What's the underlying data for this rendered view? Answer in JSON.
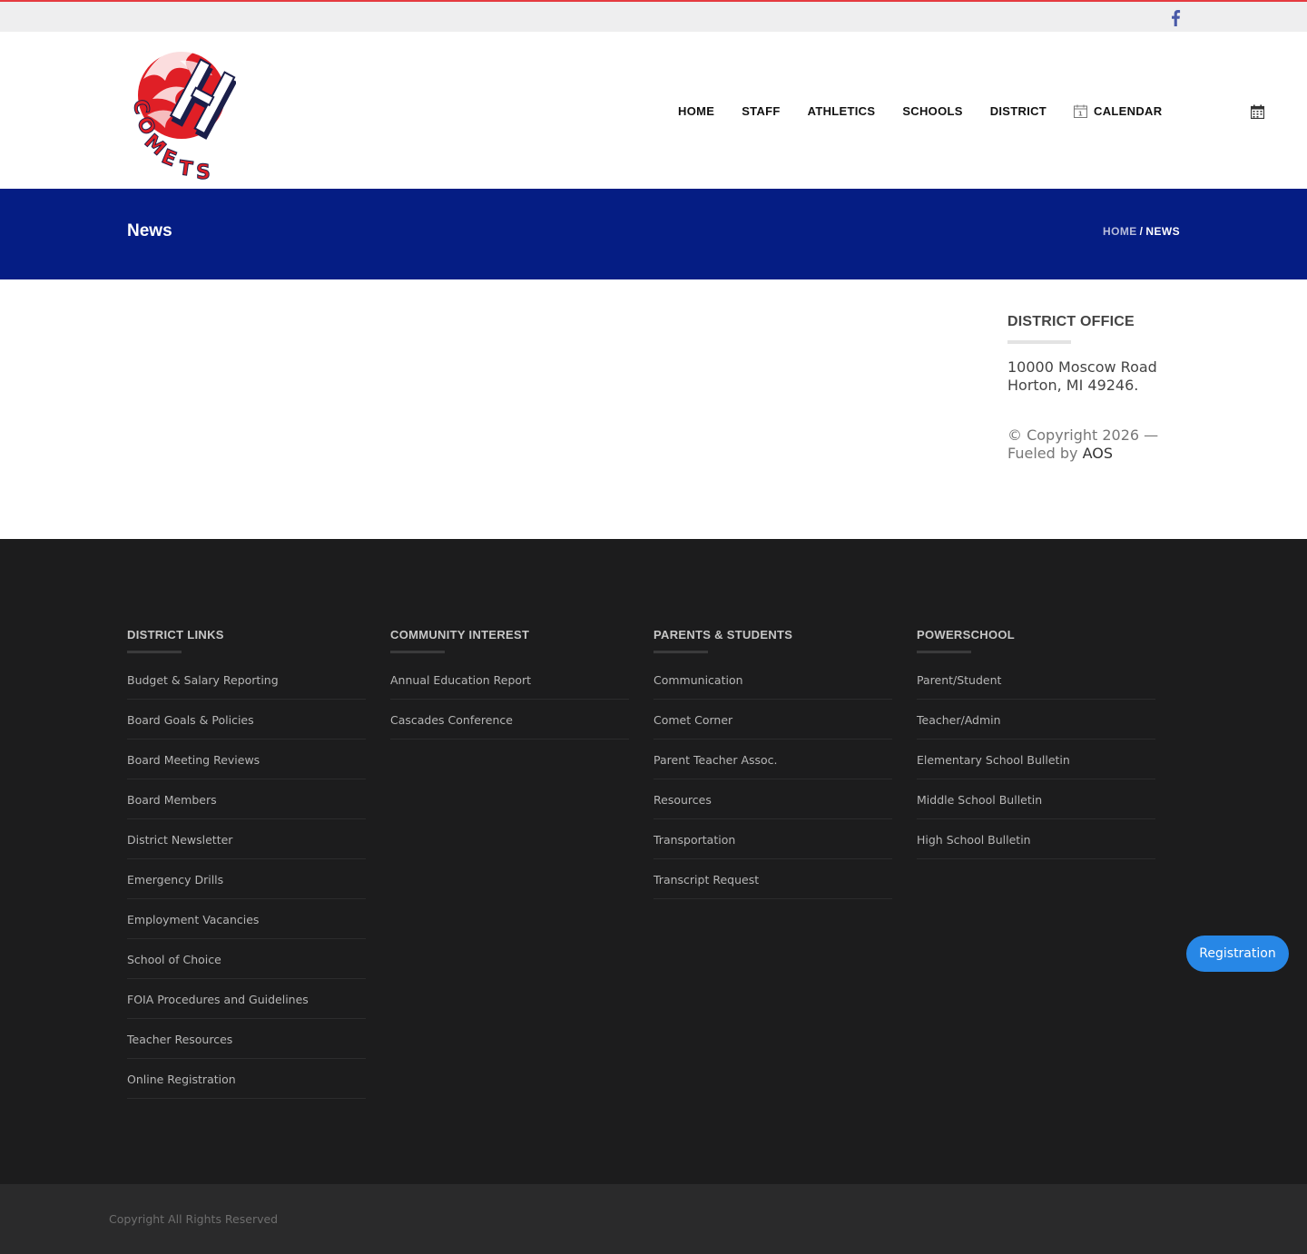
{
  "topbar": {
    "social_icon": "facebook-icon",
    "accent_color": "#e53a40"
  },
  "header": {
    "logo_text": "COMETS",
    "logo_colors": {
      "primary": "#e01f26",
      "secondary": "#1b1f4a"
    },
    "nav": [
      {
        "label": "HOME"
      },
      {
        "label": "STAFF"
      },
      {
        "label": "ATHLETICS"
      },
      {
        "label": "SCHOOLS"
      },
      {
        "label": "DISTRICT"
      },
      {
        "label": "CALENDAR",
        "icon": "calendar-icon"
      }
    ],
    "right_icon": "calendar-icon"
  },
  "banner": {
    "title": "News",
    "breadcrumb": {
      "home": "HOME",
      "separator": "/",
      "current": "NEWS"
    },
    "background_color": "#051d84"
  },
  "sidebar": {
    "title": "DISTRICT OFFICE",
    "address_line1": "10000 Moscow Road",
    "address_line2": "Horton, MI 49246.",
    "copyright_line1": "© Copyright 2026 —",
    "copyright_prefix": "Fueled by ",
    "copyright_link": "AOS"
  },
  "footer": {
    "columns": [
      {
        "title": "DISTRICT LINKS",
        "links": [
          "Budget & Salary Reporting",
          "Board Goals & Policies",
          "Board Meeting Reviews",
          "Board Members",
          "District Newsletter",
          "Emergency Drills",
          "Employment Vacancies",
          "School of Choice",
          "FOIA Procedures and Guidelines",
          "Teacher Resources",
          "Online Registration"
        ]
      },
      {
        "title": "COMMUNITY INTEREST",
        "links": [
          "Annual Education Report",
          "Cascades Conference"
        ]
      },
      {
        "title": "PARENTS & STUDENTS",
        "links": [
          "Communication",
          "Comet Corner",
          "Parent Teacher Assoc.",
          "Resources",
          "Transportation",
          "Transcript Request"
        ]
      },
      {
        "title": "POWERSCHOOL",
        "links": [
          "Parent/Student",
          "Teacher/Admin",
          "Elementary School Bulletin",
          "Middle School Bulletin",
          "High School Bulletin"
        ]
      }
    ],
    "registration_button": "Registration",
    "registration_color": "#2787e6",
    "bottom_copyright": "Copyright All Rights Reserved"
  }
}
